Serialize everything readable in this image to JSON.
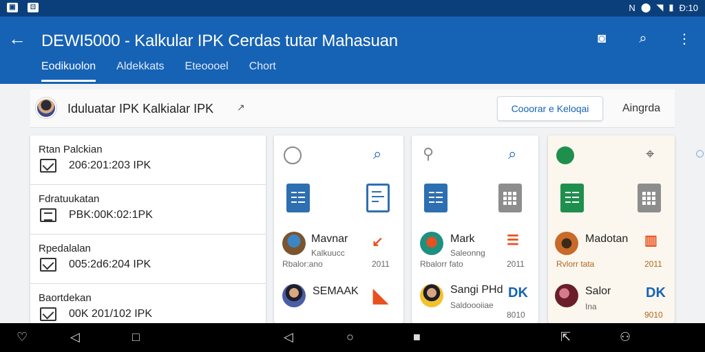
{
  "status_bar": {
    "left_icons": [
      "gallery-icon",
      "cast-icon"
    ],
    "right_icons": [
      "nfc-icon",
      "location-icon",
      "wifi-icon",
      "battery-icon"
    ],
    "time": "Ð:10"
  },
  "app_bar": {
    "title": "DEWI5000 - Kalkular IPK Cerdas tutar Mahasuan",
    "actions": [
      "contact-icon",
      "search-icon",
      "more-vert-icon"
    ]
  },
  "tabs": [
    {
      "label": "Eodikuolon",
      "active": true
    },
    {
      "label": "Aldekkats",
      "active": false
    },
    {
      "label": "Eteoooel",
      "active": false
    },
    {
      "label": "Chort",
      "active": false
    }
  ],
  "toolbar": {
    "title": "Iduluatar IPK Kalkialar IPK",
    "chevron": "↗",
    "button": "Cooorar e Keloqai",
    "link": "Aingrda"
  },
  "list": [
    {
      "title": "Rtan Palckian",
      "value": "206:201:203 IPK",
      "icon": "envelope-icon"
    },
    {
      "title": "Fdratuukatan",
      "value": "PBK:00K:02:1PK",
      "icon": "document-icon"
    },
    {
      "title": "Rpedalalan",
      "value": "005:2d6:204 IPK",
      "icon": "envelope-icon"
    },
    {
      "title": "Baortdekan",
      "value": "00K 201/102 IPK",
      "icon": "envelope-icon"
    }
  ],
  "cards": [
    {
      "top_icon": "timer-icon",
      "action_icon": "search-icon",
      "rows": [
        {
          "name": "Mavnar",
          "sub": "Kalkuucc",
          "sub2": "Rbalor:ano",
          "num": "2011",
          "mark": "↙"
        },
        {
          "name": "SEMAAK",
          "sub": "",
          "sub2": "",
          "num": "",
          "mark": "◣"
        }
      ]
    },
    {
      "top_icon": "link-icon",
      "action_icon": "search-icon",
      "rows": [
        {
          "name": "Mark",
          "sub": "Saleonng",
          "sub2": "Rbalorr fato",
          "num": "2011",
          "mark": "☰"
        },
        {
          "name": "Sangi PHd",
          "sub": "Saldoooiiae",
          "sub2": "",
          "num": "8010",
          "mark": "DK"
        }
      ]
    },
    {
      "top_icon": "chat-icon",
      "action_icon": "scan-icon",
      "rows": [
        {
          "name": "Madotan",
          "sub": "",
          "sub2": "Rvlorr tata",
          "num": "2011",
          "mark": "▥"
        },
        {
          "name": "Salor",
          "sub": "Ina",
          "sub2": "",
          "num": "9010",
          "mark": "DK"
        }
      ]
    }
  ],
  "nav_bar": [
    "heart-icon",
    "back-icon",
    "square-icon",
    "back-icon",
    "home-icon",
    "recents-icon",
    "share-icon",
    "assistant-icon"
  ],
  "colors": {
    "app_bar": "#1662b5",
    "status_bar": "#0b3f7c",
    "accent_orange": "#e8501d",
    "accent_green": "#1f8f4e"
  }
}
